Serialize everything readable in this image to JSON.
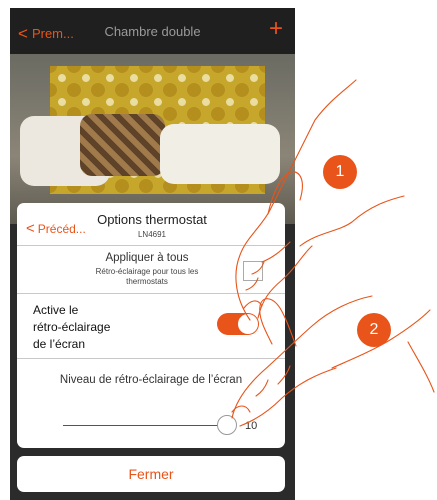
{
  "header": {
    "back_label": "Prem...",
    "title": "Chambre double",
    "add_icon": "plus-icon"
  },
  "modal": {
    "back_label": "Précéd...",
    "title": "Options thermostat",
    "subtitle": "LN4691",
    "apply_all_title": "Appliquer à tous",
    "apply_all_subtitle_line1": "Rétro-éclairage pour tous les",
    "apply_all_subtitle_line2": "thermostats",
    "backlight_line1": "Active le",
    "backlight_line2": "rétro-éclairage",
    "backlight_line3": "de l’écran",
    "backlight_enabled": true,
    "level_label": "Niveau de rétro-éclairage de l’écran",
    "level_value": "10"
  },
  "close_button": {
    "label": "Fermer"
  },
  "steps": {
    "step1": "1",
    "step2": "2"
  },
  "colors": {
    "accent": "#e8541a",
    "dark": "#2b2b2b"
  }
}
